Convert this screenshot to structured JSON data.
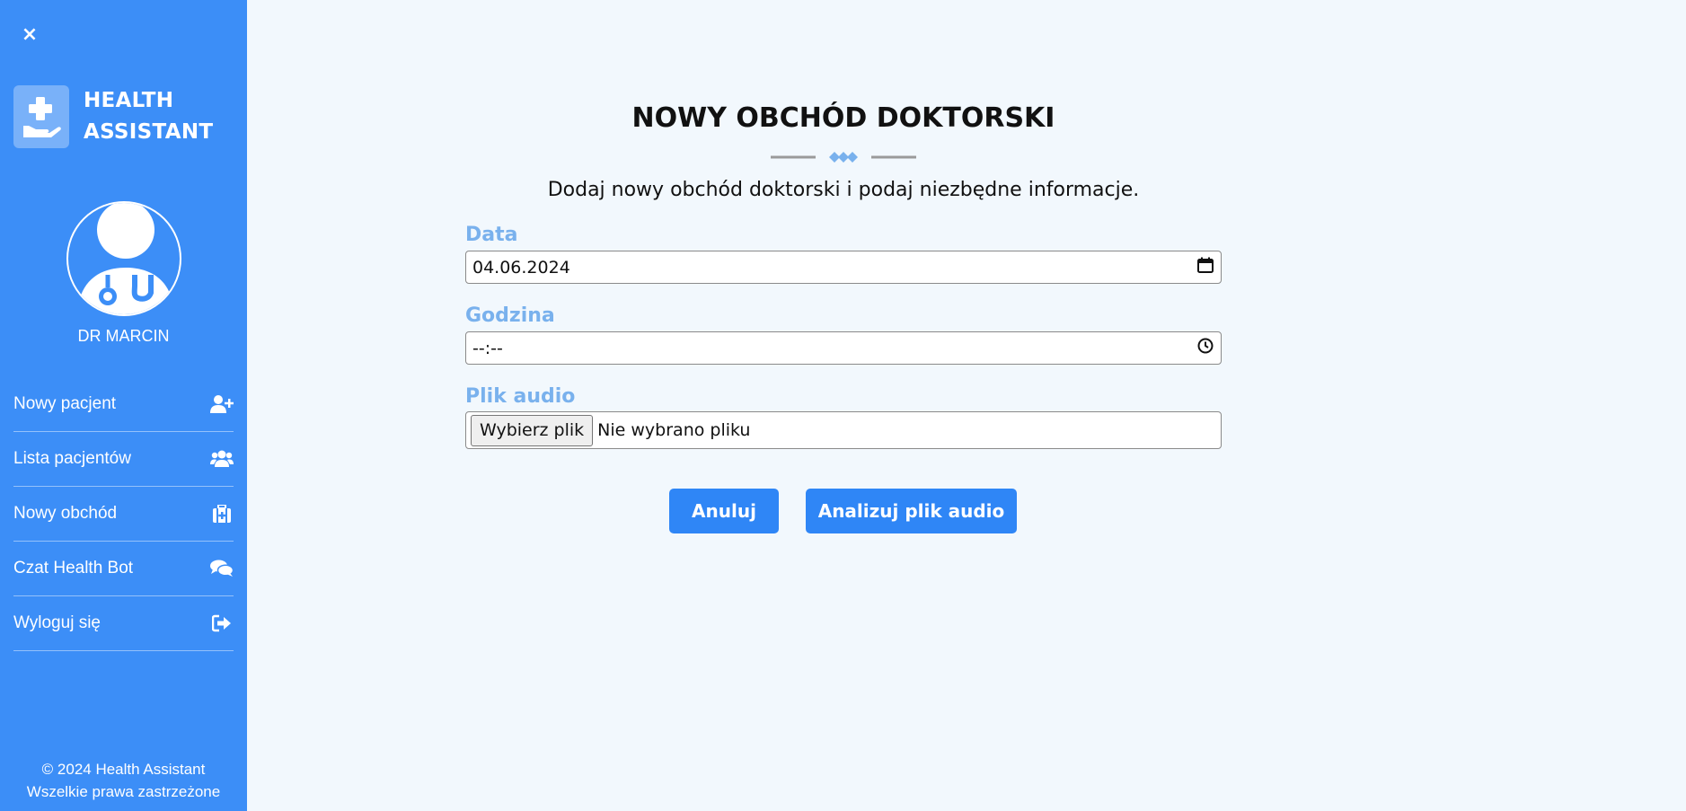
{
  "sidebar": {
    "close_label": "×",
    "brand_line1": "HEALTH",
    "brand_line2": "ASSISTANT",
    "username": "DR MARCIN",
    "items": [
      {
        "label": "Nowy pacjent",
        "icon": "user-plus-icon"
      },
      {
        "label": "Lista pacjentów",
        "icon": "users-icon"
      },
      {
        "label": "Nowy obchód",
        "icon": "medical-kit-icon"
      },
      {
        "label": "Czat Health Bot",
        "icon": "chat-icon"
      },
      {
        "label": "Wyloguj się",
        "icon": "logout-icon"
      }
    ],
    "footer_line1": "© 2024 Health Assistant",
    "footer_line2": "Wszelkie prawa zastrzeżone"
  },
  "main": {
    "title": "NOWY OBCHÓD DOKTORSKI",
    "subtitle": "Dodaj nowy obchód doktorski i podaj niezbędne informacje.",
    "date_label": "Data",
    "date_value": "04.06.2024",
    "time_label": "Godzina",
    "time_value": "--:--",
    "file_label": "Plik audio",
    "file_button": "Wybierz plik",
    "file_status": "Nie wybrano pliku",
    "cancel_button": "Anuluj",
    "analyze_button": "Analizuj plik audio"
  },
  "colors": {
    "sidebar_bg": "#3c8ef7",
    "accent": "#2f86f6",
    "label": "#79b1ed",
    "background": "#f2f8fd"
  }
}
